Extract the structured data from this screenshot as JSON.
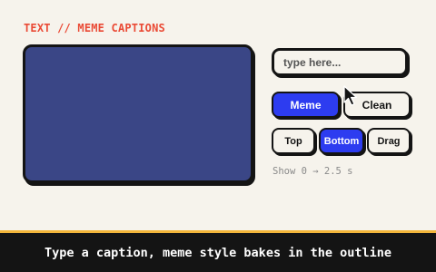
{
  "section_label": "TEXT // MEME CAPTIONS",
  "caption": {
    "placeholder": "type here...",
    "value": ""
  },
  "style_buttons": [
    {
      "label": "Meme",
      "active": true
    },
    {
      "label": "Clean",
      "active": false
    }
  ],
  "position_buttons": [
    {
      "label": "Top",
      "active": false
    },
    {
      "label": "Bottom",
      "active": true
    },
    {
      "label": "Drag",
      "active": false
    }
  ],
  "timing_text": "Show 0 → 2.5 s",
  "footer_caption": "Type a caption, meme style bakes in the outline",
  "colors": {
    "accent": "#2d3cf0",
    "label": "#ea4a35",
    "preview": "#3a4686",
    "footer_border": "#f2b53a"
  },
  "icons": {
    "cursor": "mouse-pointer-icon"
  }
}
